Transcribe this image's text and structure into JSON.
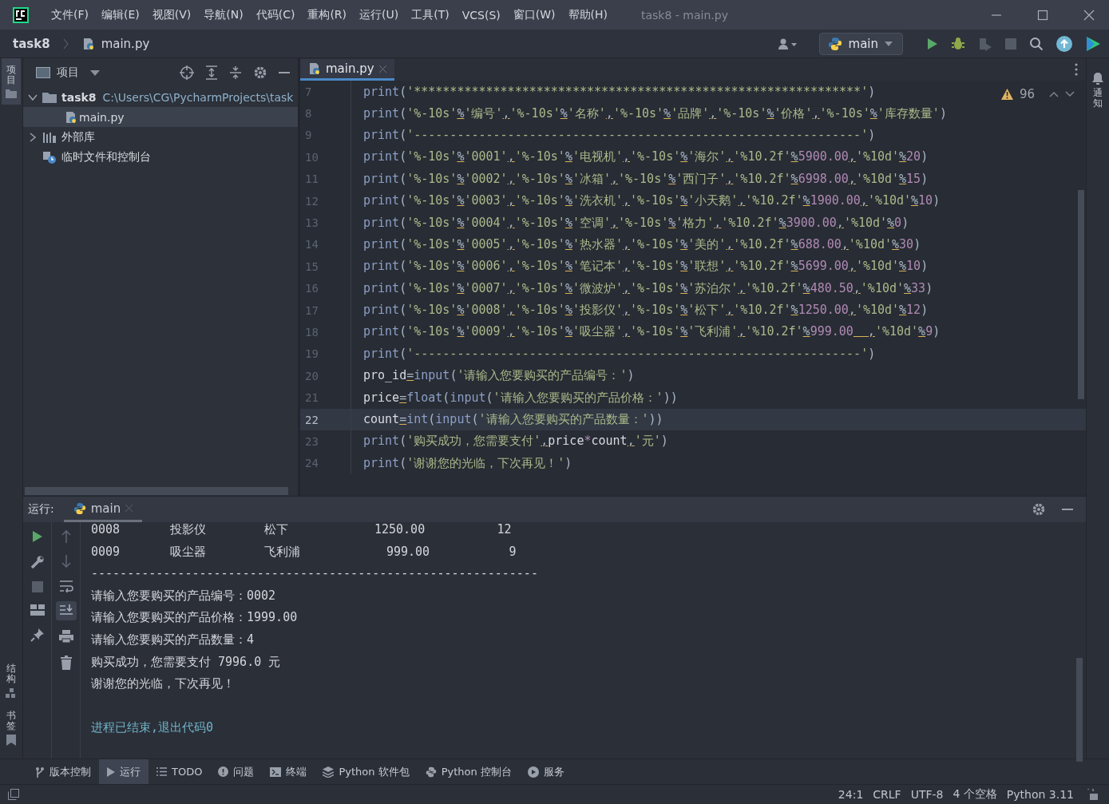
{
  "title_bar": {
    "menu": [
      "文件(F)",
      "编辑(E)",
      "视图(V)",
      "导航(N)",
      "代码(C)",
      "重构(R)",
      "运行(U)",
      "工具(T)",
      "VCS(S)",
      "窗口(W)",
      "帮助(H)"
    ],
    "title": "task8 - main.py"
  },
  "breadcrumb": [
    "task8",
    "main.py"
  ],
  "toolbar": {
    "run_config": "main"
  },
  "left_stripe": [
    {
      "label": "项目",
      "selected": true,
      "kind": "project"
    },
    {
      "label": "结构",
      "selected": false,
      "kind": "structure"
    },
    {
      "label": "书签",
      "selected": false,
      "kind": "bookmark"
    }
  ],
  "right_stripe": [
    {
      "label": "通知",
      "kind": "bell"
    }
  ],
  "project_panel": {
    "title": "项目",
    "tree": [
      {
        "name": "task8",
        "path": "C:\\Users\\CG\\PycharmProjects\\task",
        "kind": "folder",
        "expanded": true,
        "children": [
          {
            "name": "main.py",
            "kind": "python",
            "selected": true
          }
        ]
      },
      {
        "name": "外部库",
        "kind": "library",
        "expanded": false
      },
      {
        "name": "临时文件和控制台",
        "kind": "scratch"
      }
    ]
  },
  "editor": {
    "tabs": [
      {
        "label": "main.py",
        "selected": true
      }
    ],
    "warnings": "96",
    "lines": [
      {
        "number": "7",
        "current": false,
        "tokens": [
          {
            "kind": "f",
            "text": "print"
          },
          {
            "kind": "p",
            "text": "("
          },
          {
            "kind": "s",
            "text": "'**************************************************************'"
          },
          {
            "kind": "p",
            "text": ")"
          }
        ]
      },
      {
        "number": "8",
        "current": false,
        "tokens": [
          {
            "kind": "f",
            "text": "print"
          },
          {
            "kind": "p",
            "text": "("
          },
          {
            "kind": "s",
            "text": "'%-10s'"
          },
          {
            "kind": "o",
            "text": "%"
          },
          {
            "kind": "s",
            "text": "'编号'"
          },
          {
            "kind": "o",
            "text": ","
          },
          {
            "kind": "s",
            "text": "'%-10s'"
          },
          {
            "kind": "o",
            "text": "%"
          },
          {
            "kind": "s",
            "text": "'名称'"
          },
          {
            "kind": "o",
            "text": ","
          },
          {
            "kind": "s",
            "text": "'%-10s'"
          },
          {
            "kind": "o",
            "text": "%"
          },
          {
            "kind": "s",
            "text": "'品牌'"
          },
          {
            "kind": "o",
            "text": ","
          },
          {
            "kind": "s",
            "text": "'%-10s'"
          },
          {
            "kind": "o",
            "text": "%"
          },
          {
            "kind": "s",
            "text": "'价格'"
          },
          {
            "kind": "o",
            "text": ","
          },
          {
            "kind": "s",
            "text": "'%-10s'"
          },
          {
            "kind": "o",
            "text": "%"
          },
          {
            "kind": "s",
            "text": "'库存数量'"
          },
          {
            "kind": "p",
            "text": ")"
          }
        ]
      },
      {
        "number": "9",
        "current": false,
        "tokens": [
          {
            "kind": "f",
            "text": "print"
          },
          {
            "kind": "p",
            "text": "("
          },
          {
            "kind": "s",
            "text": "'--------------------------------------------------------------'"
          },
          {
            "kind": "p",
            "text": ")"
          }
        ]
      },
      {
        "number": "10",
        "current": false,
        "tokens": [
          {
            "kind": "f",
            "text": "print"
          },
          {
            "kind": "p",
            "text": "("
          },
          {
            "kind": "s",
            "text": "'%-10s'"
          },
          {
            "kind": "o",
            "text": "%"
          },
          {
            "kind": "s",
            "text": "'0001'"
          },
          {
            "kind": "o",
            "text": ","
          },
          {
            "kind": "s",
            "text": "'%-10s'"
          },
          {
            "kind": "o",
            "text": "%"
          },
          {
            "kind": "s",
            "text": "'电视机'"
          },
          {
            "kind": "o",
            "text": ","
          },
          {
            "kind": "s",
            "text": "'%-10s'"
          },
          {
            "kind": "o",
            "text": "%"
          },
          {
            "kind": "s",
            "text": "'海尔'"
          },
          {
            "kind": "o",
            "text": ","
          },
          {
            "kind": "s",
            "text": "'%10.2f'"
          },
          {
            "kind": "o",
            "text": "%"
          },
          {
            "kind": "n",
            "text": "5900.00"
          },
          {
            "kind": "o",
            "text": ","
          },
          {
            "kind": "s",
            "text": "'%10d'"
          },
          {
            "kind": "o",
            "text": "%"
          },
          {
            "kind": "n",
            "text": "20"
          },
          {
            "kind": "p",
            "text": ")"
          }
        ]
      },
      {
        "number": "11",
        "current": false,
        "tokens": [
          {
            "kind": "f",
            "text": "print"
          },
          {
            "kind": "p",
            "text": "("
          },
          {
            "kind": "s",
            "text": "'%-10s'"
          },
          {
            "kind": "o",
            "text": "%"
          },
          {
            "kind": "s",
            "text": "'0002'"
          },
          {
            "kind": "o",
            "text": ","
          },
          {
            "kind": "s",
            "text": "'%-10s'"
          },
          {
            "kind": "o",
            "text": "%"
          },
          {
            "kind": "s",
            "text": "'冰箱'"
          },
          {
            "kind": "o",
            "text": ","
          },
          {
            "kind": "s",
            "text": "'%-10s'"
          },
          {
            "kind": "o",
            "text": "%"
          },
          {
            "kind": "s",
            "text": "'西门子'"
          },
          {
            "kind": "o",
            "text": ","
          },
          {
            "kind": "s",
            "text": "'%10.2f'"
          },
          {
            "kind": "o",
            "text": "%"
          },
          {
            "kind": "n",
            "text": "6998.00"
          },
          {
            "kind": "o",
            "text": ","
          },
          {
            "kind": "s",
            "text": "'%10d'"
          },
          {
            "kind": "o",
            "text": "%"
          },
          {
            "kind": "n",
            "text": "15"
          },
          {
            "kind": "p",
            "text": ")"
          }
        ]
      },
      {
        "number": "12",
        "current": false,
        "tokens": [
          {
            "kind": "f",
            "text": "print"
          },
          {
            "kind": "p",
            "text": "("
          },
          {
            "kind": "s",
            "text": "'%-10s'"
          },
          {
            "kind": "o",
            "text": "%"
          },
          {
            "kind": "s",
            "text": "'0003'"
          },
          {
            "kind": "o",
            "text": ","
          },
          {
            "kind": "s",
            "text": "'%-10s'"
          },
          {
            "kind": "o",
            "text": "%"
          },
          {
            "kind": "s",
            "text": "'洗衣机'"
          },
          {
            "kind": "o",
            "text": ","
          },
          {
            "kind": "s",
            "text": "'%-10s'"
          },
          {
            "kind": "o",
            "text": "%"
          },
          {
            "kind": "s",
            "text": "'小天鹅'"
          },
          {
            "kind": "o",
            "text": ","
          },
          {
            "kind": "s",
            "text": "'%10.2f'"
          },
          {
            "kind": "o",
            "text": "%"
          },
          {
            "kind": "n",
            "text": "1900.00"
          },
          {
            "kind": "o",
            "text": ","
          },
          {
            "kind": "s",
            "text": "'%10d'"
          },
          {
            "kind": "o",
            "text": "%"
          },
          {
            "kind": "n",
            "text": "10"
          },
          {
            "kind": "p",
            "text": ")"
          }
        ]
      },
      {
        "number": "13",
        "current": false,
        "tokens": [
          {
            "kind": "f",
            "text": "print"
          },
          {
            "kind": "p",
            "text": "("
          },
          {
            "kind": "s",
            "text": "'%-10s'"
          },
          {
            "kind": "o",
            "text": "%"
          },
          {
            "kind": "s",
            "text": "'0004'"
          },
          {
            "kind": "o",
            "text": ","
          },
          {
            "kind": "s",
            "text": "'%-10s'"
          },
          {
            "kind": "o",
            "text": "%"
          },
          {
            "kind": "s",
            "text": "'空调'"
          },
          {
            "kind": "o",
            "text": ","
          },
          {
            "kind": "s",
            "text": "'%-10s'"
          },
          {
            "kind": "o",
            "text": "%"
          },
          {
            "kind": "s",
            "text": "'格力'"
          },
          {
            "kind": "o",
            "text": ","
          },
          {
            "kind": "s",
            "text": "'%10.2f'"
          },
          {
            "kind": "o",
            "text": "%"
          },
          {
            "kind": "n",
            "text": "3900.00"
          },
          {
            "kind": "o",
            "text": ","
          },
          {
            "kind": "s",
            "text": "'%10d'"
          },
          {
            "kind": "o",
            "text": "%"
          },
          {
            "kind": "n",
            "text": "0"
          },
          {
            "kind": "p",
            "text": ")"
          }
        ]
      },
      {
        "number": "14",
        "current": false,
        "tokens": [
          {
            "kind": "f",
            "text": "print"
          },
          {
            "kind": "p",
            "text": "("
          },
          {
            "kind": "s",
            "text": "'%-10s'"
          },
          {
            "kind": "o",
            "text": "%"
          },
          {
            "kind": "s",
            "text": "'0005'"
          },
          {
            "kind": "o",
            "text": ","
          },
          {
            "kind": "s",
            "text": "'%-10s'"
          },
          {
            "kind": "o",
            "text": "%"
          },
          {
            "kind": "s",
            "text": "'热水器'"
          },
          {
            "kind": "o",
            "text": ","
          },
          {
            "kind": "s",
            "text": "'%-10s'"
          },
          {
            "kind": "o",
            "text": "%"
          },
          {
            "kind": "s",
            "text": "'美的'"
          },
          {
            "kind": "o",
            "text": ","
          },
          {
            "kind": "s",
            "text": "'%10.2f'"
          },
          {
            "kind": "o",
            "text": "%"
          },
          {
            "kind": "n",
            "text": "688.00"
          },
          {
            "kind": "o",
            "text": ","
          },
          {
            "kind": "s",
            "text": "'%10d'"
          },
          {
            "kind": "o",
            "text": "%"
          },
          {
            "kind": "n",
            "text": "30"
          },
          {
            "kind": "p",
            "text": ")"
          }
        ]
      },
      {
        "number": "15",
        "current": false,
        "tokens": [
          {
            "kind": "f",
            "text": "print"
          },
          {
            "kind": "p",
            "text": "("
          },
          {
            "kind": "s",
            "text": "'%-10s'"
          },
          {
            "kind": "o",
            "text": "%"
          },
          {
            "kind": "s",
            "text": "'0006'"
          },
          {
            "kind": "o",
            "text": ","
          },
          {
            "kind": "s",
            "text": "'%-10s'"
          },
          {
            "kind": "o",
            "text": "%"
          },
          {
            "kind": "s",
            "text": "'笔记本'"
          },
          {
            "kind": "o",
            "text": ","
          },
          {
            "kind": "s",
            "text": "'%-10s'"
          },
          {
            "kind": "o",
            "text": "%"
          },
          {
            "kind": "s",
            "text": "'联想'"
          },
          {
            "kind": "o",
            "text": ","
          },
          {
            "kind": "s",
            "text": "'%10.2f'"
          },
          {
            "kind": "o",
            "text": "%"
          },
          {
            "kind": "n",
            "text": "5699.00"
          },
          {
            "kind": "o",
            "text": ","
          },
          {
            "kind": "s",
            "text": "'%10d'"
          },
          {
            "kind": "o",
            "text": "%"
          },
          {
            "kind": "n",
            "text": "10"
          },
          {
            "kind": "p",
            "text": ")"
          }
        ]
      },
      {
        "number": "16",
        "current": false,
        "tokens": [
          {
            "kind": "f",
            "text": "print"
          },
          {
            "kind": "p",
            "text": "("
          },
          {
            "kind": "s",
            "text": "'%-10s'"
          },
          {
            "kind": "o",
            "text": "%"
          },
          {
            "kind": "s",
            "text": "'0007'"
          },
          {
            "kind": "o",
            "text": ","
          },
          {
            "kind": "s",
            "text": "'%-10s'"
          },
          {
            "kind": "o",
            "text": "%"
          },
          {
            "kind": "s",
            "text": "'微波炉'"
          },
          {
            "kind": "o",
            "text": ","
          },
          {
            "kind": "s",
            "text": "'%-10s'"
          },
          {
            "kind": "o",
            "text": "%"
          },
          {
            "kind": "s",
            "text": "'苏泊尔'"
          },
          {
            "kind": "o",
            "text": ","
          },
          {
            "kind": "s",
            "text": "'%10.2f'"
          },
          {
            "kind": "o",
            "text": "%"
          },
          {
            "kind": "n",
            "text": "480.50"
          },
          {
            "kind": "o",
            "text": ","
          },
          {
            "kind": "s",
            "text": "'%10d'"
          },
          {
            "kind": "o",
            "text": "%"
          },
          {
            "kind": "n",
            "text": "33"
          },
          {
            "kind": "p",
            "text": ")"
          }
        ]
      },
      {
        "number": "17",
        "current": false,
        "tokens": [
          {
            "kind": "f",
            "text": "print"
          },
          {
            "kind": "p",
            "text": "("
          },
          {
            "kind": "s",
            "text": "'%-10s'"
          },
          {
            "kind": "o",
            "text": "%"
          },
          {
            "kind": "s",
            "text": "'0008'"
          },
          {
            "kind": "o",
            "text": ","
          },
          {
            "kind": "s",
            "text": "'%-10s'"
          },
          {
            "kind": "o",
            "text": "%"
          },
          {
            "kind": "s",
            "text": "'投影仪'"
          },
          {
            "kind": "o",
            "text": ","
          },
          {
            "kind": "s",
            "text": "'%-10s'"
          },
          {
            "kind": "o",
            "text": "%"
          },
          {
            "kind": "s",
            "text": "'松下'"
          },
          {
            "kind": "o",
            "text": ","
          },
          {
            "kind": "s",
            "text": "'%10.2f'"
          },
          {
            "kind": "o",
            "text": "%"
          },
          {
            "kind": "n",
            "text": "1250.00"
          },
          {
            "kind": "o",
            "text": ","
          },
          {
            "kind": "s",
            "text": "'%10d'"
          },
          {
            "kind": "o",
            "text": "%"
          },
          {
            "kind": "n",
            "text": "12"
          },
          {
            "kind": "p",
            "text": ")"
          }
        ]
      },
      {
        "number": "18",
        "current": false,
        "tokens": [
          {
            "kind": "f",
            "text": "print"
          },
          {
            "kind": "p",
            "text": "("
          },
          {
            "kind": "s",
            "text": "'%-10s'"
          },
          {
            "kind": "o",
            "text": "%"
          },
          {
            "kind": "s",
            "text": "'0009'"
          },
          {
            "kind": "o",
            "text": ","
          },
          {
            "kind": "s",
            "text": "'%-10s'"
          },
          {
            "kind": "o",
            "text": "%"
          },
          {
            "kind": "s",
            "text": "'吸尘器'"
          },
          {
            "kind": "o",
            "text": ","
          },
          {
            "kind": "s",
            "text": "'%-10s'"
          },
          {
            "kind": "o",
            "text": "%"
          },
          {
            "kind": "s",
            "text": "'飞利浦'"
          },
          {
            "kind": "o",
            "text": ","
          },
          {
            "kind": "s",
            "text": "'%10.2f'"
          },
          {
            "kind": "o",
            "text": "%"
          },
          {
            "kind": "n",
            "text": "999.00"
          },
          {
            "kind": "o",
            "text": "  ,"
          },
          {
            "kind": "s",
            "text": "'%10d'"
          },
          {
            "kind": "o",
            "text": "%"
          },
          {
            "kind": "n",
            "text": "9"
          },
          {
            "kind": "p",
            "text": ")"
          }
        ]
      },
      {
        "number": "19",
        "current": false,
        "tokens": [
          {
            "kind": "f",
            "text": "print"
          },
          {
            "kind": "p",
            "text": "("
          },
          {
            "kind": "s",
            "text": "'--------------------------------------------------------------'"
          },
          {
            "kind": "p",
            "text": ")"
          }
        ]
      },
      {
        "number": "20",
        "current": false,
        "tokens": [
          {
            "kind": "v",
            "text": "pro_id"
          },
          {
            "kind": "o",
            "text": "="
          },
          {
            "kind": "f",
            "text": "input"
          },
          {
            "kind": "p",
            "text": "("
          },
          {
            "kind": "s",
            "text": "'请输入您要购买的产品编号：'"
          },
          {
            "kind": "p",
            "text": ")"
          }
        ]
      },
      {
        "number": "21",
        "current": false,
        "tokens": [
          {
            "kind": "v",
            "text": "price"
          },
          {
            "kind": "o",
            "text": "="
          },
          {
            "kind": "f",
            "text": "float"
          },
          {
            "kind": "p",
            "text": "("
          },
          {
            "kind": "f",
            "text": "input"
          },
          {
            "kind": "p",
            "text": "("
          },
          {
            "kind": "s",
            "text": "'请输入您要购买的产品价格：'"
          },
          {
            "kind": "p",
            "text": "))"
          }
        ]
      },
      {
        "number": "22",
        "current": true,
        "tokens": [
          {
            "kind": "v",
            "text": "count"
          },
          {
            "kind": "o",
            "text": "="
          },
          {
            "kind": "f",
            "text": "int"
          },
          {
            "kind": "p",
            "text": "("
          },
          {
            "kind": "f",
            "text": "input"
          },
          {
            "kind": "p",
            "text": "("
          },
          {
            "kind": "s",
            "text": "'请输入您要购买的产品数量：'"
          },
          {
            "kind": "p",
            "text": "))"
          }
        ]
      },
      {
        "number": "23",
        "current": false,
        "tokens": [
          {
            "kind": "f",
            "text": "print"
          },
          {
            "kind": "p",
            "text": "("
          },
          {
            "kind": "s",
            "text": "'购买成功，您需要支付'"
          },
          {
            "kind": "o",
            "text": ","
          },
          {
            "kind": "v",
            "text": "price"
          },
          {
            "kind": "k",
            "text": "*"
          },
          {
            "kind": "v",
            "text": "count"
          },
          {
            "kind": "o",
            "text": ","
          },
          {
            "kind": "s",
            "text": "'元'"
          },
          {
            "kind": "p",
            "text": ")"
          }
        ]
      },
      {
        "number": "24",
        "current": false,
        "tokens": [
          {
            "kind": "f",
            "text": "print"
          },
          {
            "kind": "p",
            "text": "("
          },
          {
            "kind": "s",
            "text": "'谢谢您的光临，下次再见！'"
          },
          {
            "kind": "p",
            "text": ")"
          }
        ]
      }
    ]
  },
  "run_panel": {
    "label": "运行:",
    "tabs": [
      {
        "label": "main",
        "selected": true
      }
    ],
    "output": [
      {
        "kind": "out",
        "text": "0008       投影仪        松下            1250.00          12"
      },
      {
        "kind": "out",
        "text": "0009       吸尘器        飞利浦            999.00           9"
      },
      {
        "kind": "out",
        "text": "--------------------------------------------------------------"
      },
      {
        "kind": "out",
        "text": "请输入您要购买的产品编号：0002"
      },
      {
        "kind": "out",
        "text": "请输入您要购买的产品价格：1999.00"
      },
      {
        "kind": "out",
        "text": "请输入您要购买的产品数量：4"
      },
      {
        "kind": "out",
        "text": "购买成功，您需要支付 7996.0 元"
      },
      {
        "kind": "out",
        "text": "谢谢您的光临，下次再见！"
      },
      {
        "kind": "exit",
        "text": "进程已结束,退出代码0"
      }
    ]
  },
  "tool_tabs": [
    {
      "label": "版本控制",
      "kind": "vcs",
      "selected": false
    },
    {
      "label": "运行",
      "kind": "run",
      "selected": true
    },
    {
      "label": "TODO",
      "kind": "todo",
      "selected": false
    },
    {
      "label": "问题",
      "kind": "problems",
      "selected": false
    },
    {
      "label": "终端",
      "kind": "terminal",
      "selected": false
    },
    {
      "label": "Python 软件包",
      "kind": "packages",
      "selected": false
    },
    {
      "label": "Python 控制台",
      "kind": "console",
      "selected": false
    },
    {
      "label": "服务",
      "kind": "services",
      "selected": false
    }
  ],
  "status_bar": [
    "24:1",
    "CRLF",
    "UTF-8",
    "4 个空格",
    "Python 3.11"
  ]
}
